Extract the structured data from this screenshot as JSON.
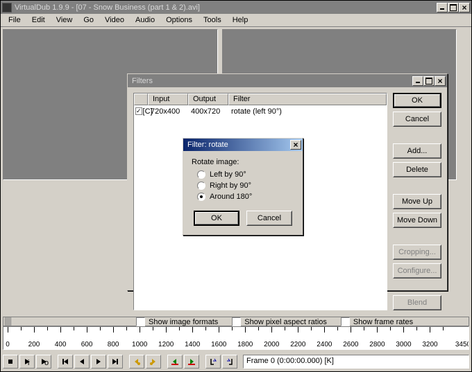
{
  "mainWindow": {
    "title": "VirtualDub 1.9.9 - [07 - Snow Business (part 1 & 2).avi]"
  },
  "menu": [
    "File",
    "Edit",
    "View",
    "Go",
    "Video",
    "Audio",
    "Options",
    "Tools",
    "Help"
  ],
  "ruler": {
    "ticks": [
      0,
      200,
      400,
      600,
      800,
      1000,
      1200,
      1400,
      1600,
      1800,
      2000,
      2200,
      2400,
      2600,
      2800,
      3000,
      3200
    ],
    "end": 3450
  },
  "frameStatus": "Frame 0 (0:00:00.000) [K]",
  "filtersDialog": {
    "title": "Filters",
    "columns": {
      "input": "Input",
      "output": "Output",
      "filter": "Filter"
    },
    "row": {
      "tag": "[C]",
      "input": "720x400",
      "output": "400x720",
      "name": "rotate (left 90°)"
    },
    "buttons": {
      "ok": "OK",
      "cancel": "Cancel",
      "add": "Add...",
      "delete": "Delete",
      "moveUp": "Move Up",
      "moveDown": "Move Down",
      "cropping": "Cropping...",
      "configure": "Configure...",
      "blend": "Blend"
    },
    "checks": {
      "imageFormats": "Show image formats",
      "pixelAspect": "Show pixel aspect ratios",
      "frameRates": "Show frame rates"
    }
  },
  "rotateDialog": {
    "title": "Filter: rotate",
    "group": "Rotate image:",
    "left": "Left by 90°",
    "right": "Right by 90°",
    "around": "Around 180°",
    "ok": "OK",
    "cancel": "Cancel"
  },
  "toolbarIcons": [
    "stop",
    "play",
    "play-out",
    "seek-start",
    "seek-back",
    "seek-fwd",
    "seek-end",
    "key-prev",
    "key-next",
    "scene-prev",
    "scene-next",
    "mark-in",
    "mark-out"
  ]
}
